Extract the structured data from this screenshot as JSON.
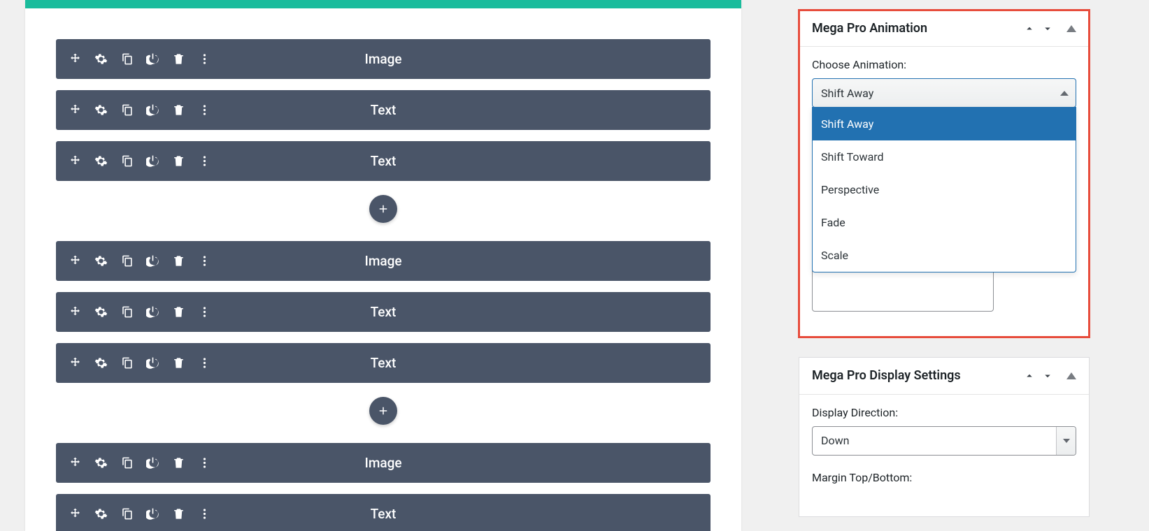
{
  "editor": {
    "groups": [
      {
        "blocks": [
          {
            "label": "Image"
          },
          {
            "label": "Text"
          },
          {
            "label": "Text"
          }
        ]
      },
      {
        "blocks": [
          {
            "label": "Image"
          },
          {
            "label": "Text"
          },
          {
            "label": "Text"
          }
        ]
      },
      {
        "blocks": [
          {
            "label": "Image"
          },
          {
            "label": "Text"
          }
        ]
      }
    ]
  },
  "sidebar": {
    "animation_panel": {
      "title": "Mega Pro Animation",
      "field_label": "Choose Animation:",
      "selected": "Shift Away",
      "options": [
        "Shift Away",
        "Shift Toward",
        "Perspective",
        "Fade",
        "Scale"
      ]
    },
    "display_panel": {
      "title": "Mega Pro Display Settings",
      "direction_label": "Display Direction:",
      "direction_value": "Down",
      "margin_label": "Margin Top/Bottom:"
    }
  }
}
